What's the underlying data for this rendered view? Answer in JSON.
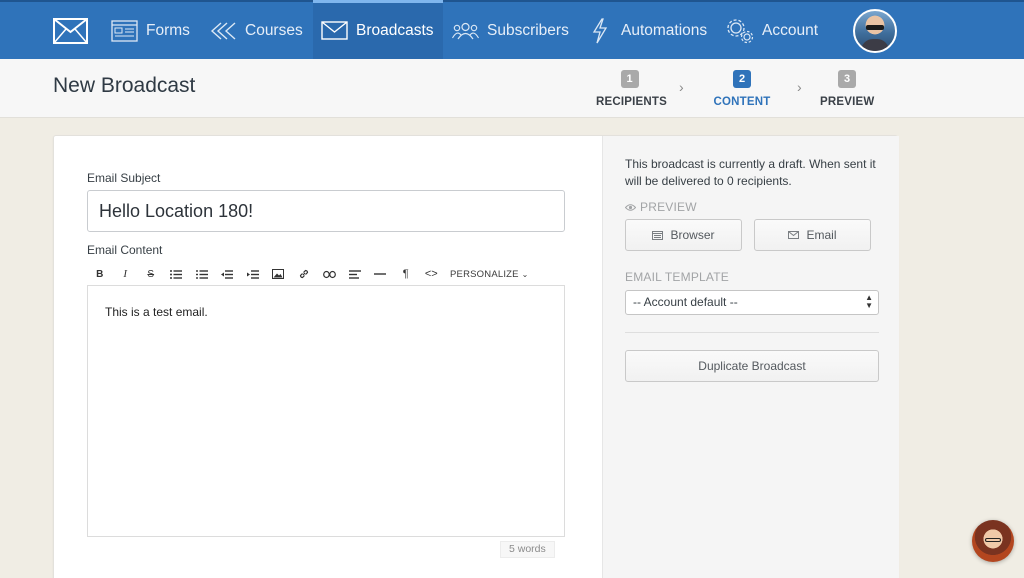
{
  "nav": {
    "items": [
      {
        "label": "Forms",
        "icon": "forms-icon"
      },
      {
        "label": "Courses",
        "icon": "courses-icon"
      },
      {
        "label": "Broadcasts",
        "icon": "envelope-icon",
        "active": true
      },
      {
        "label": "Subscribers",
        "icon": "subscribers-icon"
      },
      {
        "label": "Automations",
        "icon": "lightning-icon"
      },
      {
        "label": "Account",
        "icon": "gears-icon"
      }
    ]
  },
  "header": {
    "title": "New Broadcast",
    "steps": [
      {
        "num": "1",
        "label": "RECIPIENTS"
      },
      {
        "num": "2",
        "label": "CONTENT",
        "active": true
      },
      {
        "num": "3",
        "label": "PREVIEW"
      }
    ]
  },
  "editor": {
    "subject_label": "Email Subject",
    "subject_value": "Hello Location 180!",
    "content_label": "Email Content",
    "personalize_label": "PERSONALIZE",
    "body_text": "This is a test email.",
    "word_count": "5 words",
    "toolbar_buttons": [
      "bold",
      "italic",
      "strikethrough",
      "bullet-list",
      "numbered-list",
      "outdent",
      "indent",
      "image",
      "link",
      "unlink",
      "align",
      "horizontal-rule",
      "paragraph",
      "code"
    ]
  },
  "sidebar": {
    "draft_notice": "This broadcast is currently a draft. When sent it will be delivered to 0 recipients.",
    "preview_label": "PREVIEW",
    "browser_button": "Browser",
    "email_button": "Email",
    "template_label": "EMAIL TEMPLATE",
    "template_value": "-- Account default --",
    "duplicate_button": "Duplicate Broadcast"
  },
  "colors": {
    "nav_bg": "#2f73ba",
    "accent": "#2f73ba",
    "page_bg": "#f0ede4"
  }
}
